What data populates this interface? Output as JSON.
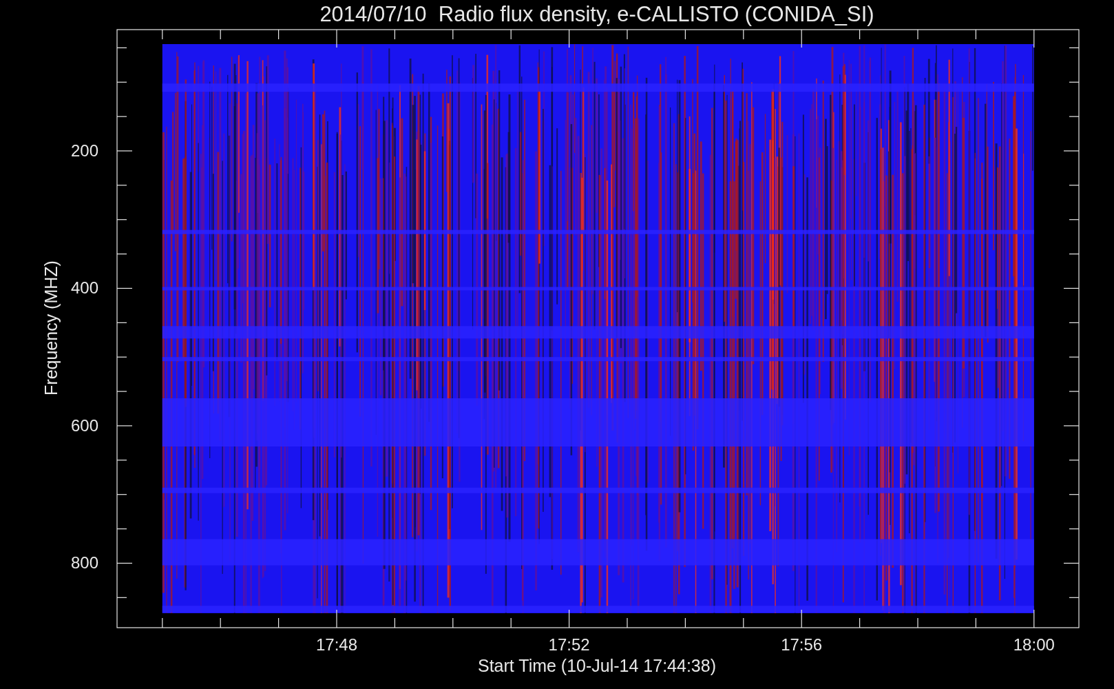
{
  "plot": {
    "title": "2014/07/10  Radio flux density, e-CALLISTO (CONIDA_SI)",
    "y_axis_label": "Frequency (MHZ)",
    "x_axis_label": "Start Time (10-Jul-14 17:44:38)",
    "y_tick_labels": [
      "200",
      "400",
      "600",
      "800"
    ],
    "x_tick_labels": [
      "17:48",
      "17:52",
      "17:56",
      "18:00"
    ]
  }
}
